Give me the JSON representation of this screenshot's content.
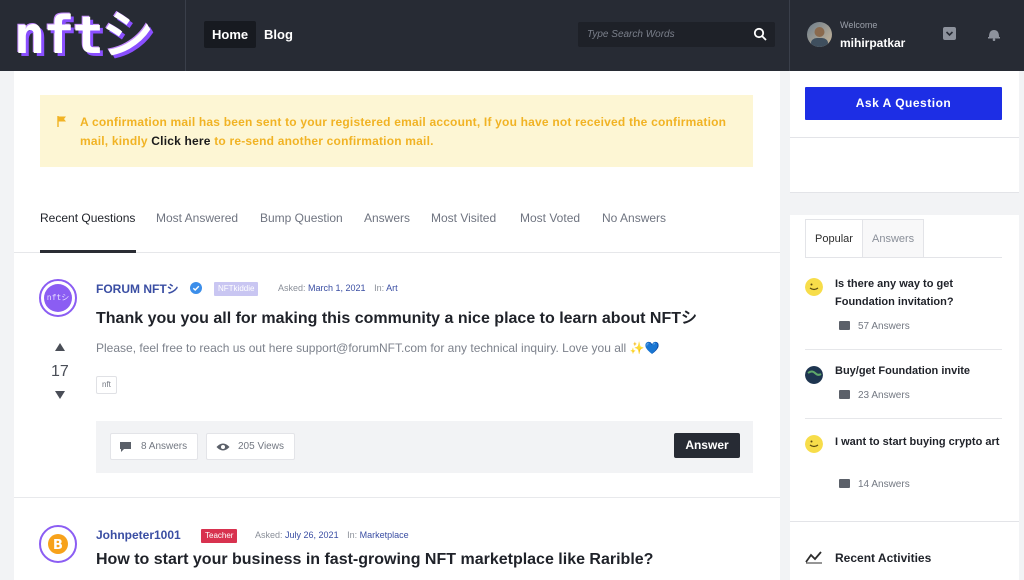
{
  "header": {
    "logo_text": "nftシ",
    "nav": [
      {
        "label": "Home",
        "active": true
      },
      {
        "label": "Blog",
        "active": false
      }
    ],
    "search_placeholder": "Type Search Words",
    "welcome_label": "Welcome",
    "username": "mihirpatkar"
  },
  "notice": {
    "text_before": "A confirmation mail has been sent to your registered email account, If you have not received the confirmation mail, kindly ",
    "link_text": "Click here",
    "text_after": " to re-send another confirmation mail."
  },
  "tabs": [
    "Recent Questions",
    "Most Answered",
    "Bump Question",
    "Answers",
    "Most Visited",
    "Most Voted",
    "No Answers"
  ],
  "questions": [
    {
      "author": "FORUM NFTシ",
      "avatar_text": "nftシ",
      "badge": "NFTkiddie",
      "badge_color": "#c9c6f2",
      "asked_label": "Asked:",
      "asked_date": "March 1, 2021",
      "in_label": "In:",
      "category": "Art",
      "title": "Thank you you all for making this community a nice place to learn about NFTシ",
      "excerpt": "Please, feel free to reach us out here support@forumNFT.com for any technical inquiry. Love you all ✨💙",
      "votes": "17",
      "tag": "nft",
      "answers": "8 Answers",
      "views": "205 Views",
      "answer_button": "Answer"
    },
    {
      "author": "Johnpeter1001",
      "badge": "Teacher",
      "badge_color": "#d8324f",
      "asked_label": "Asked:",
      "asked_date": "July 26, 2021",
      "in_label": "In:",
      "category": "Marketplace",
      "title": "How to start your business in fast-growing NFT marketplace like Rarible?"
    }
  ],
  "sidebar": {
    "ask_button": "Ask A Question",
    "popular_tabs": [
      "Popular",
      "Answers"
    ],
    "popular": [
      {
        "title": "Is there any way to get Foundation invitation?",
        "answers": "57 Answers"
      },
      {
        "title": "Buy/get Foundation invite",
        "answers": "23 Answers"
      },
      {
        "title": "I want to start buying crypto art",
        "answers": "14 Answers"
      }
    ],
    "recent_title": "Recent Activities"
  },
  "colors": {
    "accent": "#1d2ee5",
    "header": "#272b34",
    "notice_bg": "#fdf6d4",
    "notice_text": "#f1b324"
  }
}
